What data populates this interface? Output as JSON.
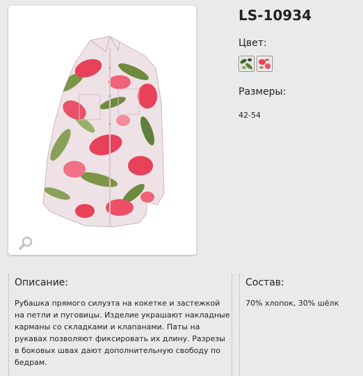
{
  "product": {
    "sku": "LS-10934",
    "image_alt": "floral-shirt-photo"
  },
  "color": {
    "label": "Цвет:",
    "swatches": [
      "green-floral",
      "red-floral"
    ]
  },
  "sizes": {
    "label": "Размеры:",
    "value": "42-54"
  },
  "description": {
    "title": "Описание:",
    "text": "Рубашка прямого силуэта на кокетке и застежкой на петли и пуговицы. Изделие украшают накладные карманы со складками и клапанами. Паты на рукавах позволяют фиксировать их длину. Разрезы в боковых швах дают дополнительную свободу по бедрам."
  },
  "composition": {
    "title": "Состав:",
    "text": "70% хлопок, 30% шёлк"
  },
  "colors": {
    "background": "#e9eaeb",
    "flower_red": "#e8415a",
    "leaf_green": "#6e8a3e"
  },
  "icons": {
    "zoom": "magnifier-icon"
  }
}
